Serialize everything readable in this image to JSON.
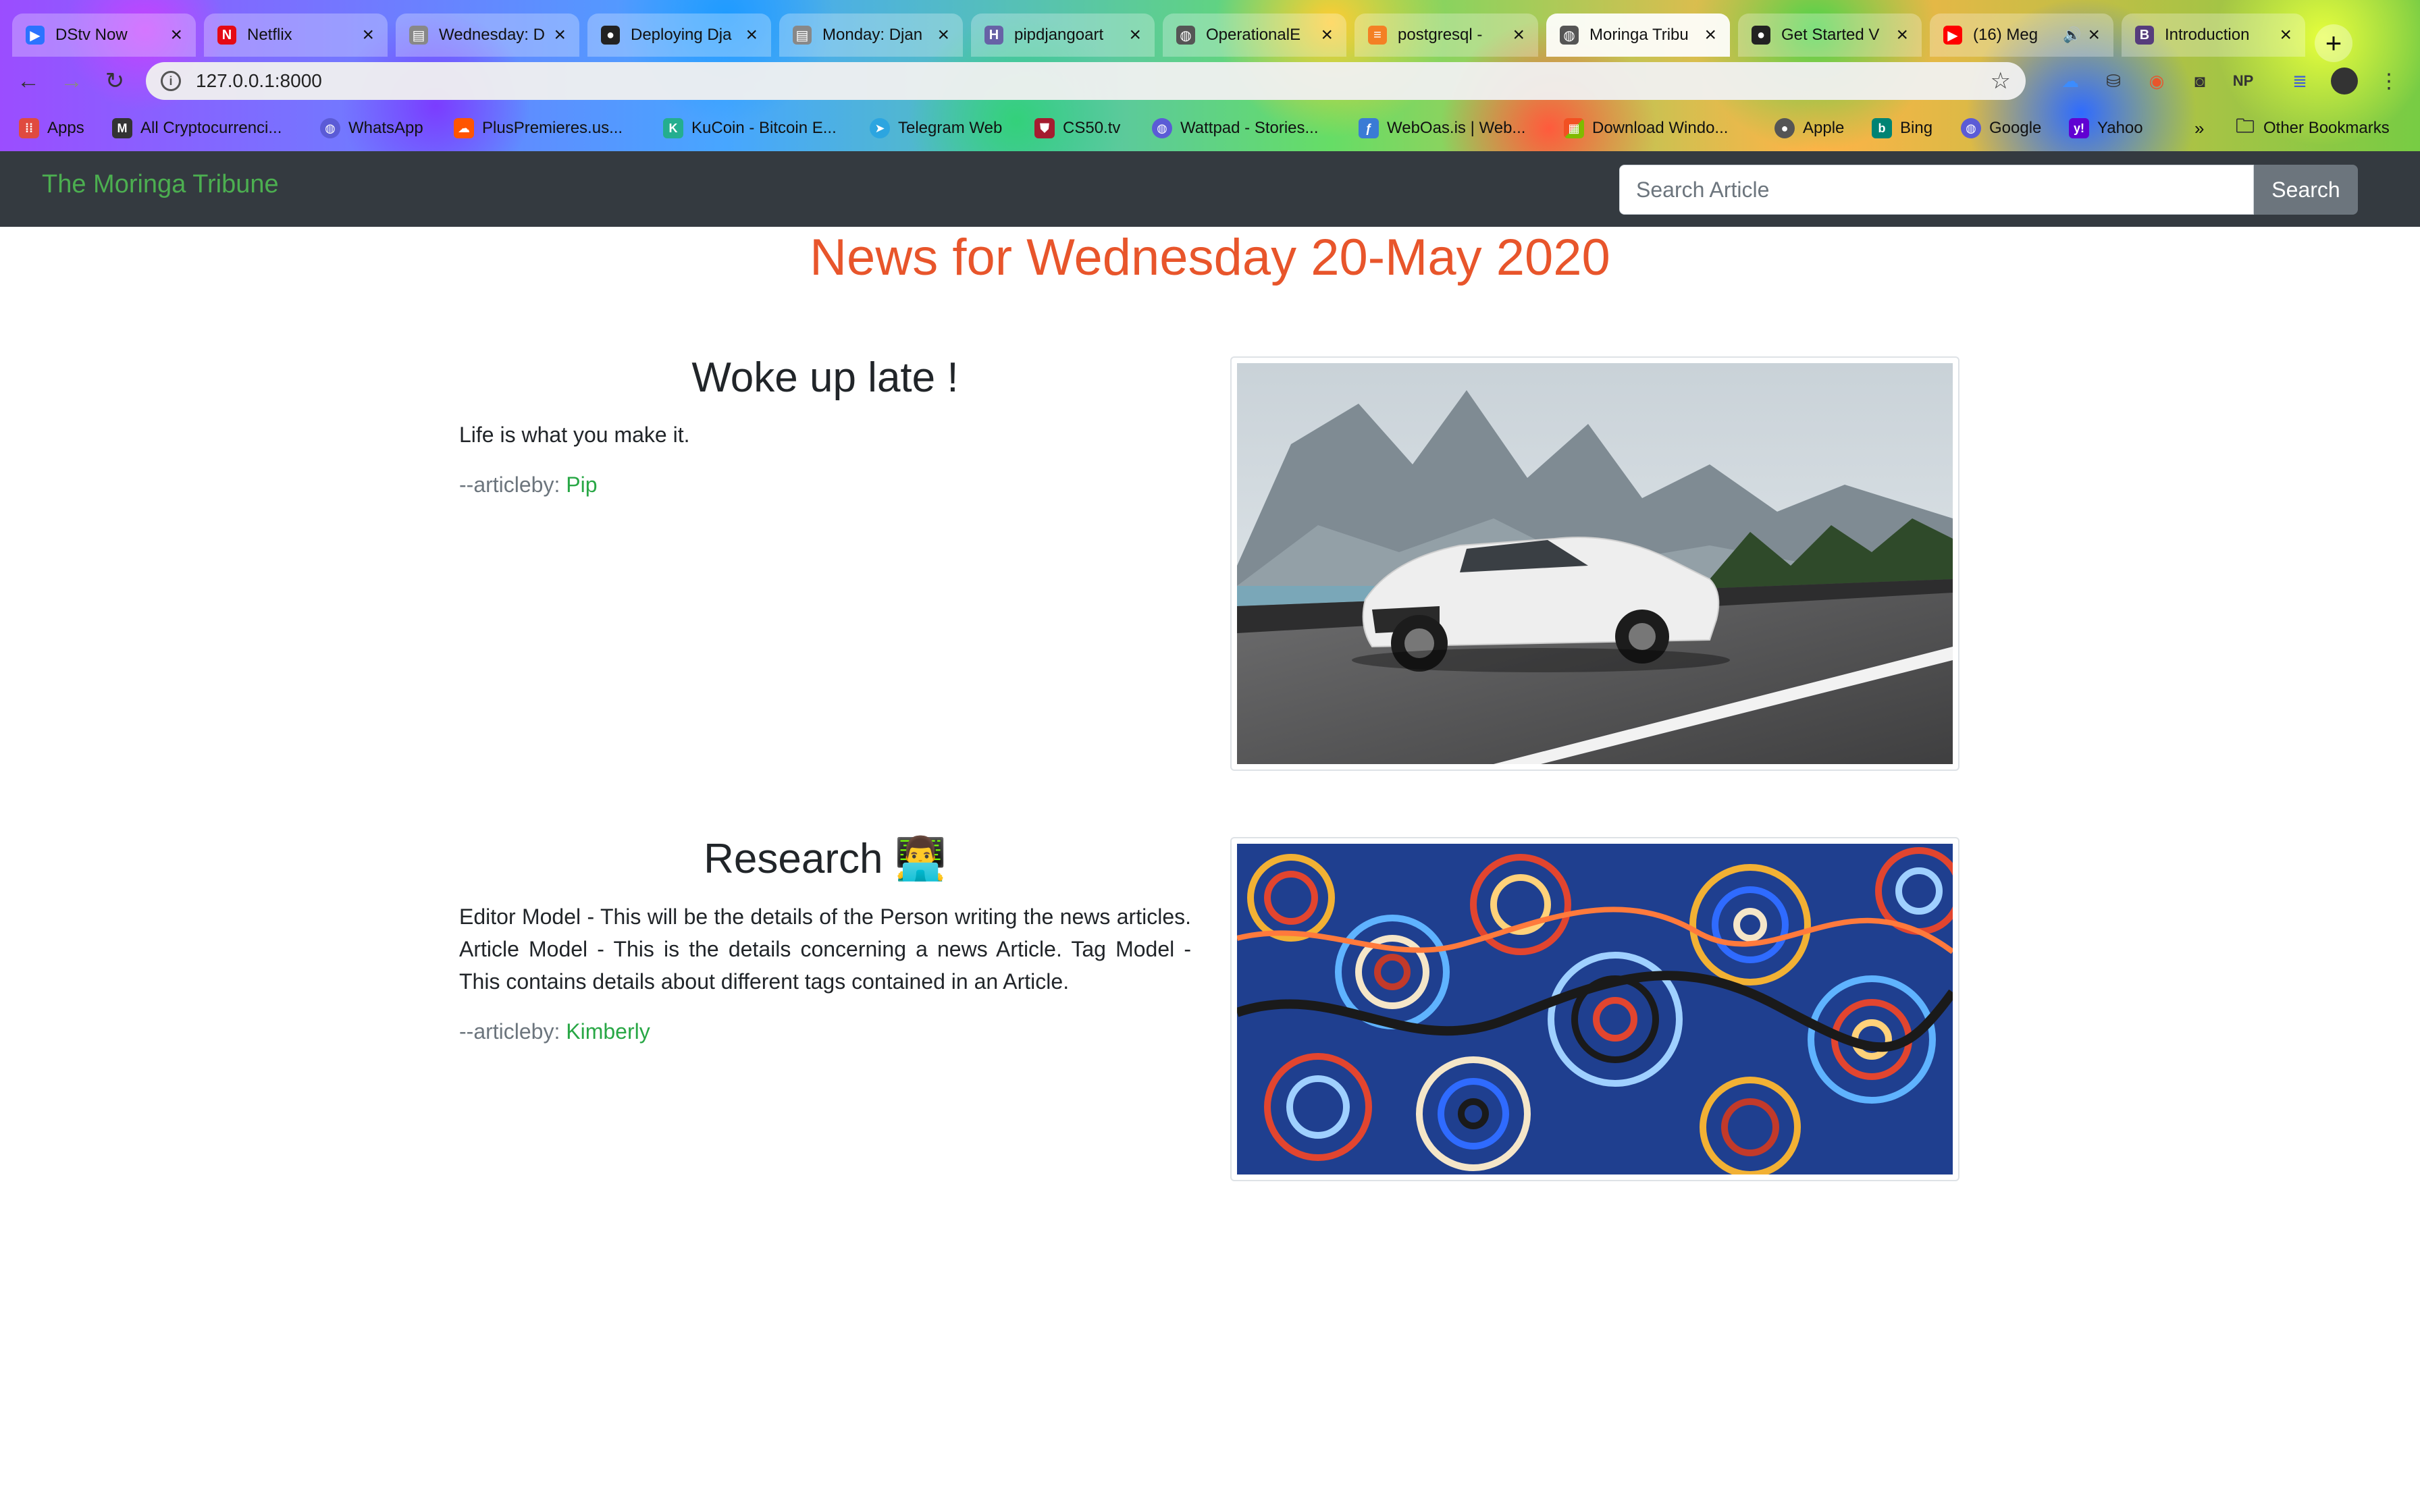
{
  "browser": {
    "tabs": [
      {
        "title": "DStv Now",
        "icon": "dstv-play-icon",
        "color": "#2b73ff"
      },
      {
        "title": "Netflix",
        "icon": "netflix-icon",
        "color": "#e50914"
      },
      {
        "title": "Wednesday: D",
        "icon": "doc-icon",
        "color": "#888888"
      },
      {
        "title": "Deploying Dja",
        "icon": "github-icon",
        "color": "#222222"
      },
      {
        "title": "Monday: Djan",
        "icon": "doc-icon",
        "color": "#888888"
      },
      {
        "title": "pipdjangoart",
        "icon": "heroku-icon",
        "color": "#6762a6"
      },
      {
        "title": "OperationalE",
        "icon": "globe-icon",
        "color": "#555555"
      },
      {
        "title": "postgresql -",
        "icon": "stackoverflow-icon",
        "color": "#f48024"
      },
      {
        "title": "Moringa Tribu",
        "icon": "globe-icon",
        "color": "#555555"
      },
      {
        "title": "Get Started V",
        "icon": "github-icon",
        "color": "#222222"
      },
      {
        "title": "(16) Meg",
        "icon": "youtube-icon",
        "color": "#ff0000"
      },
      {
        "title": "Introduction",
        "icon": "bootstrap-icon",
        "color": "#563d7c"
      }
    ],
    "url": "127.0.0.1:8000",
    "bookmarks": [
      {
        "label": "Apps",
        "icon": "apps-grid-icon",
        "color": "#e04a3f"
      },
      {
        "label": "All Cryptocurrenci...",
        "icon": "coinmarketcap-icon",
        "color": "#333333"
      },
      {
        "label": "WhatsApp",
        "icon": "globe-icon",
        "color": "#5b5bd6"
      },
      {
        "label": "PlusPremieres.us...",
        "icon": "soundcloud-icon",
        "color": "#ff5500"
      },
      {
        "label": "KuCoin - Bitcoin E...",
        "icon": "kucoin-icon",
        "color": "#24ae8f"
      },
      {
        "label": "Telegram Web",
        "icon": "telegram-icon",
        "color": "#2ca5e0"
      },
      {
        "label": "CS50.tv",
        "icon": "harvard-shield-icon",
        "color": "#a51c30"
      },
      {
        "label": "Wattpad - Stories...",
        "icon": "globe-icon",
        "color": "#5b5bd6"
      },
      {
        "label": "WebOas.is | Web...",
        "icon": "weboasis-icon",
        "color": "#3a7bd5"
      },
      {
        "label": "Download Windo...",
        "icon": "windows-icon",
        "color": "#f25022"
      },
      {
        "label": "Apple",
        "icon": "apple-icon",
        "color": "#555555"
      },
      {
        "label": "Bing",
        "icon": "bing-icon",
        "color": "#008373"
      },
      {
        "label": "Google",
        "icon": "globe-icon",
        "color": "#5b5bd6"
      },
      {
        "label": "Yahoo",
        "icon": "yahoo-icon",
        "color": "#6001d2"
      }
    ],
    "more_bookmarks": "»",
    "other_bookmarks": "Other Bookmarks"
  },
  "site": {
    "brand": "The Moringa Tribune",
    "search": {
      "placeholder": "Search Article",
      "button": "Search"
    }
  },
  "page": {
    "heading": "News for Wednesday 20-May 2020",
    "articles": [
      {
        "title": "Woke up late !",
        "body": "Life is what you make it.",
        "byline_prefix": "--articleby: ",
        "author": "Pip",
        "image": "sports-car-photo"
      },
      {
        "title": "Research 👨‍💻",
        "body": "Editor Model - This will be the details of the Person writing the news articles. Article Model - This is the details concerning a news Article. Tag Model - This contains details about different tags contained in an Article.",
        "byline_prefix": "--articleby: ",
        "author": "Kimberly",
        "image": "abstract-swirl-art"
      }
    ]
  },
  "colors": {
    "navbar_bg": "#343a40",
    "brand": "#4caf50",
    "heading": "#e8552b",
    "author_link": "#28a745",
    "search_button": "#6c757d"
  }
}
